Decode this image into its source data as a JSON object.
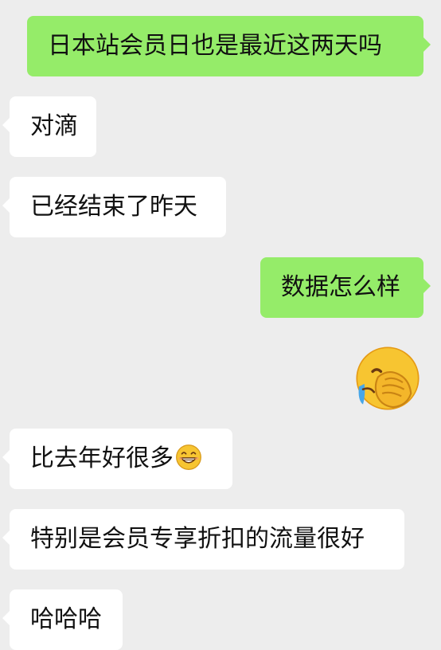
{
  "messages": [
    {
      "side": "sent",
      "text": "日本站会员日也是最近这两天吗"
    },
    {
      "side": "received",
      "text": "对滴"
    },
    {
      "side": "received",
      "text": "已经结束了昨天"
    },
    {
      "side": "sent",
      "text": "数据怎么样"
    },
    {
      "side": "sent",
      "type": "sticker",
      "icon": "facepalm-emoji-icon"
    },
    {
      "side": "received",
      "text": "比去年好很多",
      "icon": "grin-emoji-icon"
    },
    {
      "side": "received",
      "text": "特别是会员专享折扣的流量很好"
    },
    {
      "side": "received",
      "text": "哈哈哈"
    }
  ],
  "colors": {
    "background": "#ededed",
    "sent_bubble": "#95ec69",
    "received_bubble": "#ffffff",
    "text": "#111111"
  }
}
